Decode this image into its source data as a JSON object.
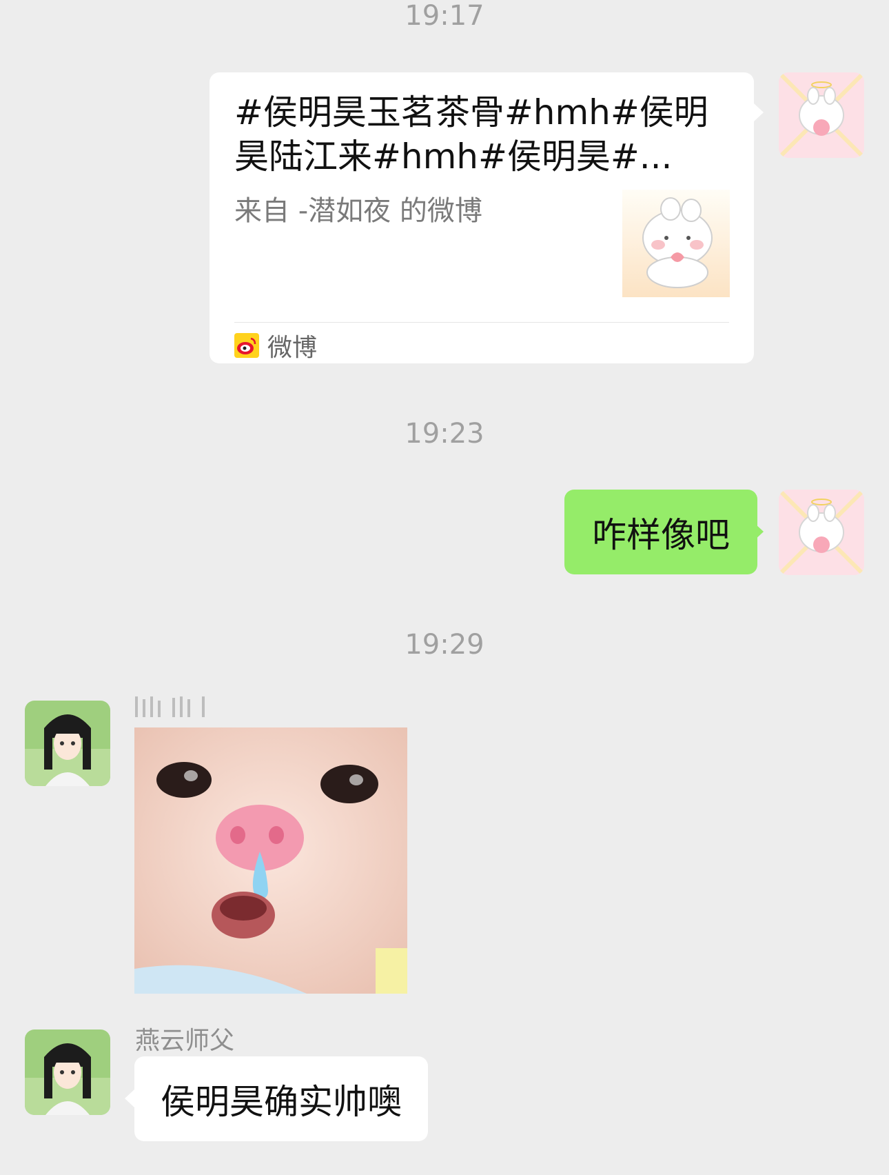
{
  "timestamps": [
    "19:17",
    "19:23",
    "19:29"
  ],
  "messages": {
    "link_card": {
      "title": "#侯明昊玉茗茶骨#hmh#侯明昊陆江来#hmh#侯明昊#...",
      "subtitle": "来自 -潜如夜 的微博",
      "source": "微博",
      "source_icon": "weibo-icon",
      "thumbnail_icon": "bunny-sticker-icon"
    },
    "sent_text": "咋样像吧",
    "received_sticker_icon": "baby-pig-nose-sticker-icon",
    "sender_name": "燕云师父",
    "received_text": "侯明昊确实帅噢"
  },
  "colors": {
    "background": "#ededed",
    "sent_bubble": "#95ec69",
    "received_bubble": "#ffffff",
    "timestamp": "#a0a0a0"
  }
}
